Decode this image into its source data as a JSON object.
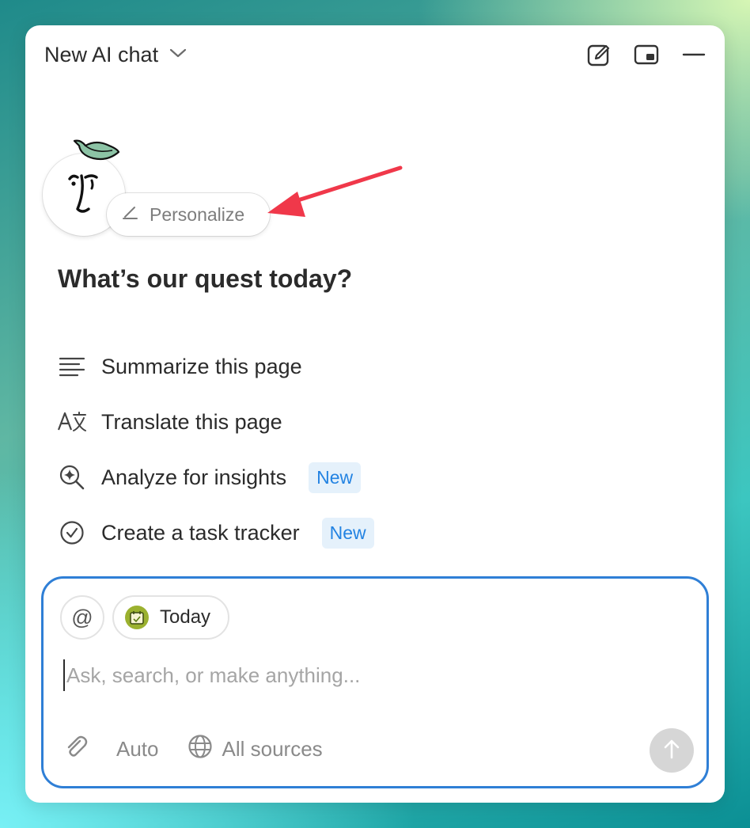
{
  "header": {
    "title": "New AI chat"
  },
  "personalize": {
    "label": "Personalize"
  },
  "main": {
    "heading": "What’s our quest today?",
    "suggestions": [
      {
        "label": "Summarize this page",
        "icon": "lines-icon"
      },
      {
        "label": "Translate this page",
        "icon": "translate-icon"
      },
      {
        "label": "Analyze for insights",
        "icon": "sparkle-search-icon",
        "badge": "New"
      },
      {
        "label": "Create a task tracker",
        "icon": "check-circle-icon",
        "badge": "New"
      }
    ]
  },
  "composer": {
    "mention_chip": "@",
    "today_chip": "Today",
    "placeholder": "Ask, search, or make anything...",
    "mode": "Auto",
    "sources": "All sources"
  },
  "colors": {
    "accent": "#2f7fd6",
    "badge_bg": "#e5f1fb",
    "badge_text": "#2383e2",
    "annotation_arrow": "#f0384a"
  }
}
